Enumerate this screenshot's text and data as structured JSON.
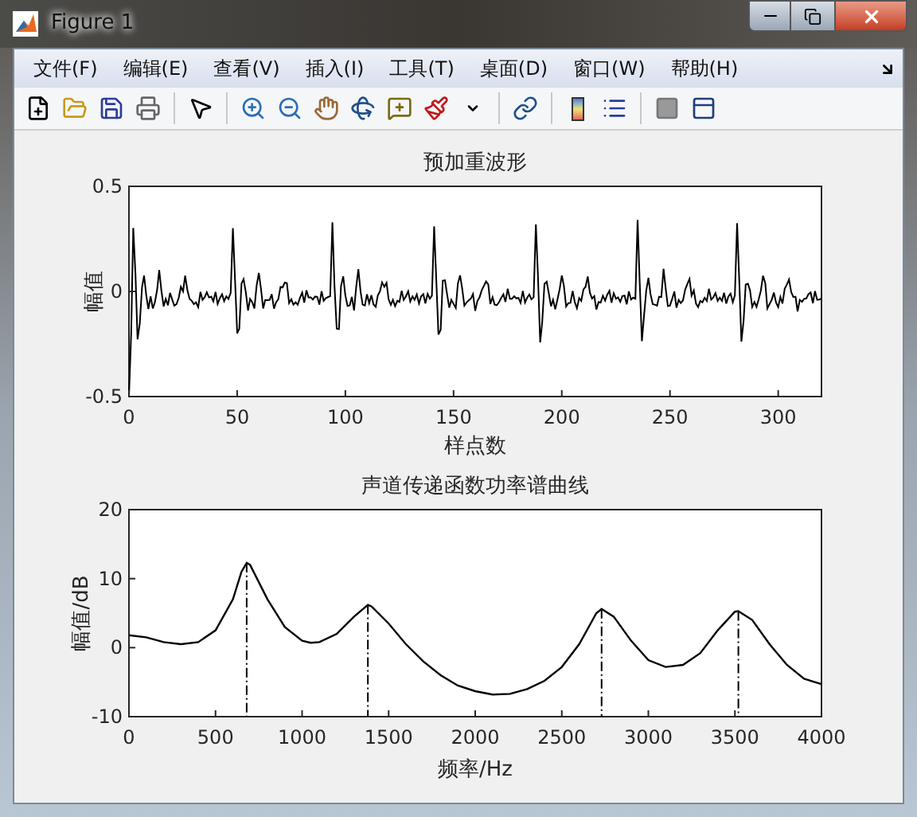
{
  "window": {
    "title": "Figure 1"
  },
  "menu": [
    {
      "label": "文件(F)"
    },
    {
      "label": "编辑(E)"
    },
    {
      "label": "查看(V)"
    },
    {
      "label": "插入(I)"
    },
    {
      "label": "工具(T)"
    },
    {
      "label": "桌面(D)"
    },
    {
      "label": "窗口(W)"
    },
    {
      "label": "帮助(H)"
    }
  ],
  "waveform_plot": {
    "title": "预加重波形",
    "xlabel": "样点数",
    "ylabel": "幅值",
    "xtick_labels": [
      "0",
      "50",
      "100",
      "150",
      "200",
      "250",
      "300"
    ],
    "ytick_labels": [
      "0.5",
      "0",
      "-0.5"
    ]
  },
  "spectrum_plot": {
    "chart_data": {
      "type": "line",
      "title": "声道传递函数功率谱曲线",
      "xlabel": "频率/Hz",
      "ylabel": "幅值/dB",
      "x": [
        0,
        100,
        200,
        300,
        400,
        500,
        600,
        650,
        680,
        700,
        800,
        900,
        1000,
        1050,
        1100,
        1200,
        1300,
        1380,
        1400,
        1500,
        1600,
        1700,
        1800,
        1900,
        2000,
        2100,
        2200,
        2300,
        2400,
        2500,
        2600,
        2700,
        2730,
        2800,
        2900,
        3000,
        3100,
        3200,
        3300,
        3400,
        3500,
        3520,
        3600,
        3700,
        3800,
        3900,
        4000
      ],
      "series": [
        {
          "color": "#000000",
          "values": [
            1.8,
            1.5,
            0.8,
            0.5,
            0.8,
            2.5,
            7,
            11,
            12.3,
            12,
            7,
            3,
            1,
            0.7,
            0.8,
            2,
            4.5,
            6.2,
            6,
            3.5,
            0.5,
            -2,
            -4,
            -5.5,
            -6.3,
            -6.8,
            -6.7,
            -6,
            -4.8,
            -2.8,
            0.5,
            5,
            5.6,
            4.5,
            1,
            -1.8,
            -2.8,
            -2.5,
            -0.8,
            2.5,
            5.2,
            5.3,
            4,
            0.5,
            -2.5,
            -4.5,
            -5.3
          ]
        }
      ],
      "xlim": [
        0,
        4000
      ],
      "ylim": [
        -10,
        20
      ],
      "xticks": [
        0,
        500,
        1000,
        1500,
        2000,
        2500,
        3000,
        3500,
        4000
      ],
      "yticks": [
        -10,
        0,
        10,
        20
      ],
      "ref_lines": [
        {
          "axis": "x",
          "value": 680
        },
        {
          "axis": "x",
          "value": 1380
        },
        {
          "axis": "x",
          "value": 2730
        },
        {
          "axis": "x",
          "value": 3520
        }
      ]
    }
  }
}
